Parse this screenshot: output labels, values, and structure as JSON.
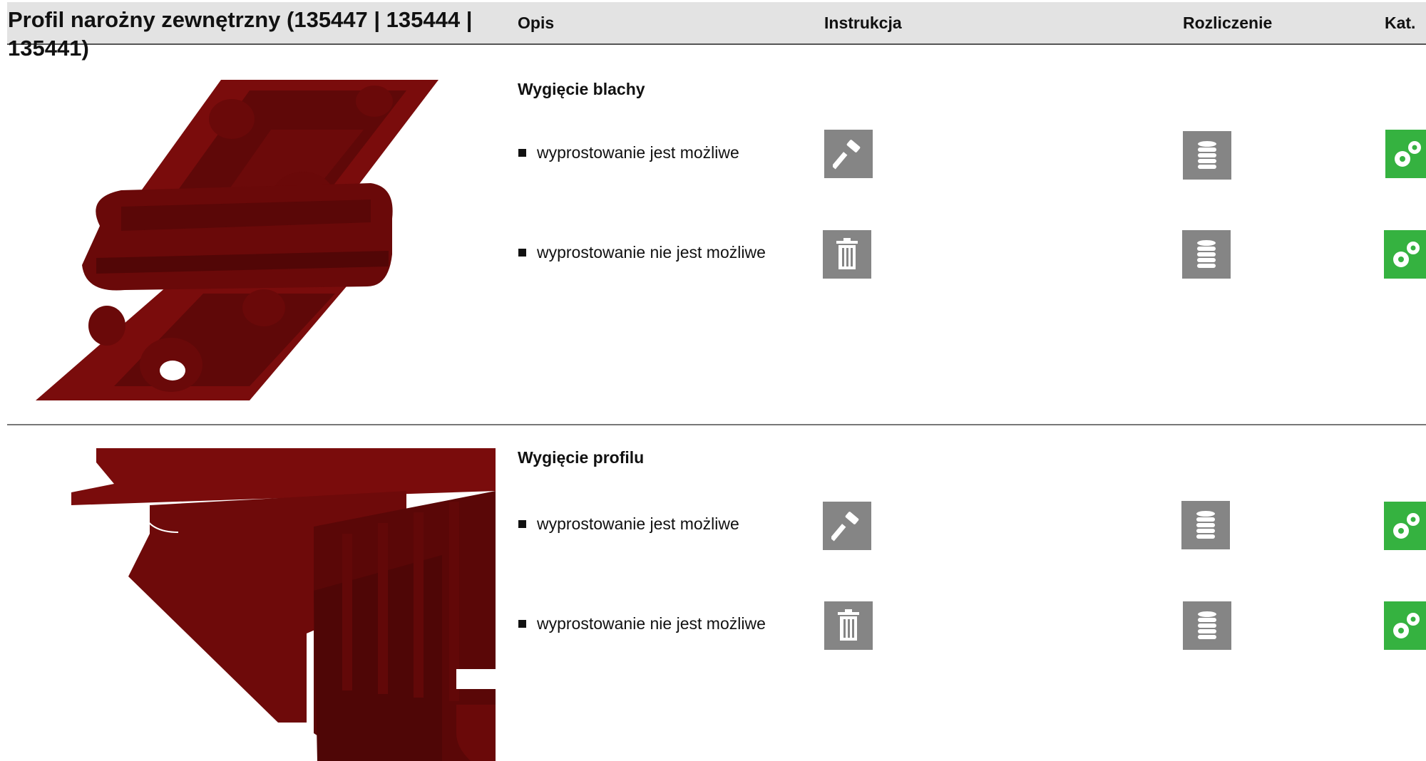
{
  "header": {
    "title": "Profil narożny zewnętrzny (135447 | 135444 | 135441)",
    "columns": {
      "opis": "Opis",
      "instrukcja": "Instrukcja",
      "rozliczenie": "Rozliczenie",
      "kat": "Kat."
    }
  },
  "sections": [
    {
      "title": "Wygięcie blachy",
      "rows": [
        {
          "text": "wyprostowanie jest możliwe",
          "instruction_icon": "hammer-icon",
          "billing_icon": "coins-icon",
          "category_icon": "gears-icon"
        },
        {
          "text": "wyprostowanie nie jest możliwe",
          "instruction_icon": "trash-icon",
          "billing_icon": "coins-icon",
          "category_icon": "gears-icon"
        }
      ]
    },
    {
      "title": "Wygięcie profilu",
      "rows": [
        {
          "text": "wyprostowanie jest możliwe",
          "instruction_icon": "hammer-icon",
          "billing_icon": "coins-icon",
          "category_icon": "gears-icon"
        },
        {
          "text": "wyprostowanie nie jest możliwe",
          "instruction_icon": "trash-icon",
          "billing_icon": "coins-icon",
          "category_icon": "gears-icon"
        }
      ]
    }
  ],
  "colors": {
    "header_bg": "#e3e3e3",
    "icon_gray": "#858585",
    "category_green": "#35b240",
    "part_red": "#7a0c0c",
    "part_dark": "#5a0707"
  }
}
